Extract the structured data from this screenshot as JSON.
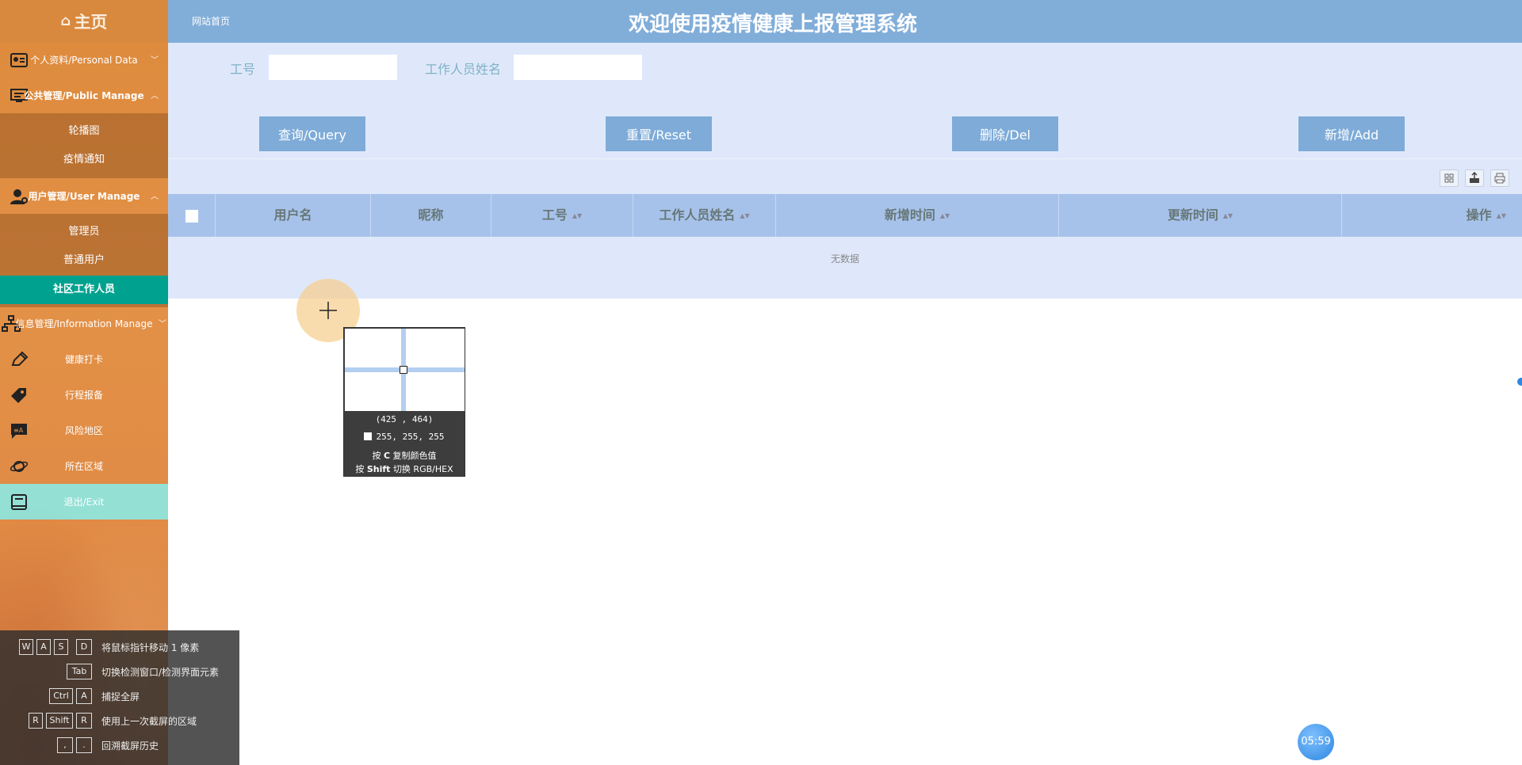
{
  "sidebar": {
    "home": "主页",
    "menus": {
      "personal": "个人资料/Personal Data",
      "public": "公共管理/Public Manage",
      "user": "用户管理/User Manage",
      "info": "信息管理/Information Manage",
      "health": "健康打卡",
      "trip": "行程报备",
      "risk": "风险地区",
      "region": "所在区域",
      "exit": "退出/Exit"
    },
    "public_sub": [
      "轮播图",
      "疫情通知"
    ],
    "user_sub": [
      "管理员",
      "普通用户",
      "社区工作人员"
    ]
  },
  "topbar": {
    "breadcrumb": "网站首页",
    "title": "欢迎使用疫情健康上报管理系统"
  },
  "search": {
    "field1_label": "工号",
    "field1_value": "",
    "field2_label": "工作人员姓名",
    "field2_value": ""
  },
  "buttons": {
    "query": "查询/Query",
    "reset": "重置/Reset",
    "delete": "删除/Del",
    "add": "新增/Add"
  },
  "table": {
    "columns": [
      "用户名",
      "昵称",
      "工号",
      "工作人员姓名",
      "新增时间",
      "更新时间",
      "操作"
    ],
    "rows": [],
    "empty_text": "无数据"
  },
  "magnifier": {
    "coords": "(425 , 464)",
    "rgb": "255, 255, 255",
    "hint1_pre": "按",
    "hint1_key": "C",
    "hint1_post": "复制颜色值",
    "hint2_pre": "按",
    "hint2_key": "Shift",
    "hint2_post": "切换 RGB/HEX"
  },
  "hotkeys": [
    {
      "keys": [
        "W",
        "A",
        "S",
        "D"
      ],
      "desc": "将鼠标指针移动 1 像素"
    },
    {
      "keys": [
        "Tab"
      ],
      "desc": "切换检测窗口/检测界面元素"
    },
    {
      "keys": [
        "Ctrl",
        "A"
      ],
      "desc": "捕捉全屏"
    },
    {
      "keys": [
        "R",
        "Shift",
        "R"
      ],
      "desc": "使用上一次截屏的区域"
    },
    {
      "keys": [
        ",",
        "."
      ],
      "desc": "回溯截屏历史"
    }
  ],
  "timer": "05:59",
  "colors": {
    "sidebar": "#e08f42",
    "topbar": "#81add9",
    "main_bg": "#dfe8fa",
    "button": "#7eabd8",
    "active_menu": "#00a28f",
    "table_header": "#a7c2ea"
  }
}
